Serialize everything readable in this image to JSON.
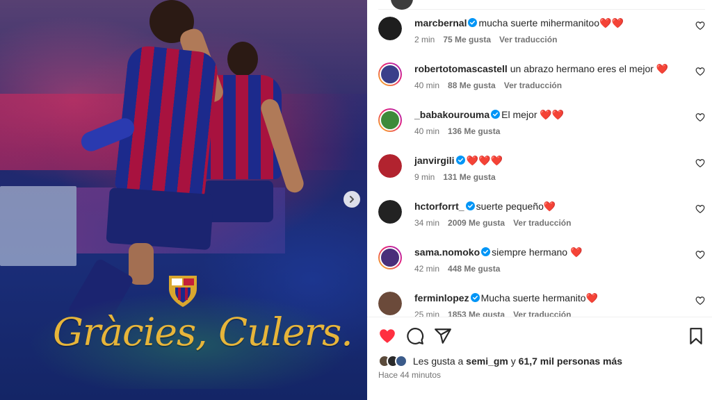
{
  "post_image": {
    "slogan": "Gràcies, Culers.",
    "next_icon": "chevron-right-icon"
  },
  "comments": [
    {
      "username": "marcbernal",
      "verified": true,
      "text": "mucha suerte mihermanitoo❤️❤️",
      "time": "2 min",
      "likes": "75 Me gusta",
      "translate": "Ver traducción",
      "avatar_color": "#1e1e1e",
      "story_ring": false
    },
    {
      "username": "robertotomascastell",
      "verified": false,
      "text": "un abrazo hermano eres el mejor ❤️",
      "time": "40 min",
      "likes": "88 Me gusta",
      "translate": "Ver traducción",
      "avatar_color": "#3a3f8a",
      "story_ring": true
    },
    {
      "username": "_babakourouma",
      "verified": true,
      "text": "El mejor ❤️❤️",
      "time": "40 min",
      "likes": "136 Me gusta",
      "translate": "",
      "avatar_color": "#3d8a3a",
      "story_ring": true
    },
    {
      "username": "janvirgili",
      "verified": true,
      "text": "❤️❤️❤️",
      "time": "9 min",
      "likes": "131 Me gusta",
      "translate": "",
      "avatar_color": "#b2232f",
      "story_ring": false
    },
    {
      "username": "hctorforrt_",
      "verified": true,
      "text": "suerte pequeño❤️",
      "time": "34 min",
      "likes": "2009 Me gusta",
      "translate": "Ver traducción",
      "avatar_color": "#222222",
      "story_ring": false
    },
    {
      "username": "sama.nomoko",
      "verified": true,
      "text": "siempre hermano ❤️",
      "time": "42 min",
      "likes": "448 Me gusta",
      "translate": "",
      "avatar_color": "#4a2f7a",
      "story_ring": true
    },
    {
      "username": "ferminlopez",
      "verified": true,
      "text": "Mucha suerte hermanito❤️",
      "time": "25 min",
      "likes": "1853 Me gusta",
      "translate": "Ver traducción",
      "avatar_color": "#6b4a3a",
      "story_ring": false
    }
  ],
  "actions": {
    "like_icon": "heart-filled-icon",
    "comment_icon": "comment-icon",
    "share_icon": "share-icon",
    "save_icon": "bookmark-icon",
    "like_color": "#ff3040"
  },
  "likes_summary": {
    "prefix": "Les gusta a",
    "user": "semi_gm",
    "connector": "y",
    "count": "61,7 mil personas más"
  },
  "timestamp": "Hace 44 minutos"
}
